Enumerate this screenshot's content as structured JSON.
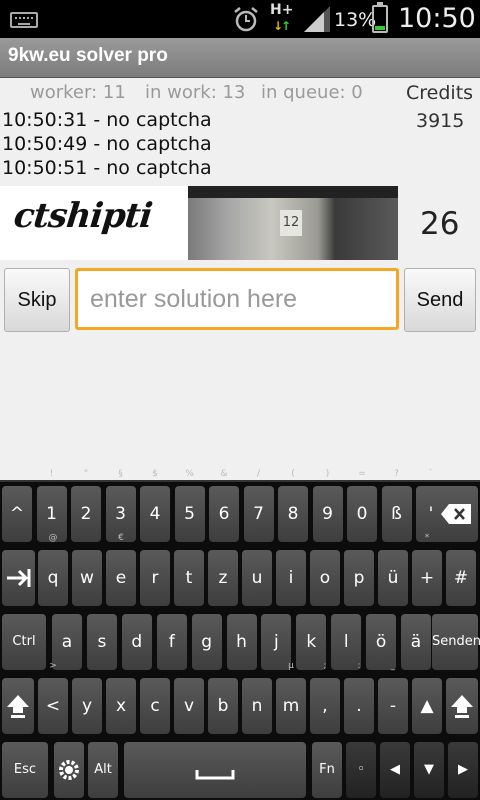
{
  "status": {
    "battery": "13%",
    "clock": "10:50",
    "network": "H+"
  },
  "app": {
    "title": "9kw.eu solver pro"
  },
  "stats": {
    "worker": "worker: 11",
    "in_work": "in work: 13",
    "in_queue": "in queue:  0",
    "credits_label": "Credits",
    "credits_value": "3915"
  },
  "log": [
    "10:50:31 - no captcha",
    "10:50:49 - no captcha",
    "10:50:51 - no captcha"
  ],
  "captcha": {
    "text": "ctshipti",
    "photo_number": "12",
    "counter": "26"
  },
  "controls": {
    "skip_label": "Skip",
    "send_label": "Send",
    "solution_placeholder": "enter solution here"
  },
  "keyboard": {
    "row1": [
      {
        "label": "^",
        "sup": ""
      },
      {
        "label": "1",
        "sup": "!"
      },
      {
        "label": "2",
        "sup": "\""
      },
      {
        "label": "3",
        "sup": "§"
      },
      {
        "label": "4",
        "sup": "$"
      },
      {
        "label": "5",
        "sup": "%"
      },
      {
        "label": "6",
        "sup": "&"
      },
      {
        "label": "7",
        "sup": "/"
      },
      {
        "label": "8",
        "sup": "("
      },
      {
        "label": "9",
        "sup": ")"
      },
      {
        "label": "0",
        "sup": "="
      },
      {
        "label": "ß",
        "sup": "?"
      },
      {
        "label": "'",
        "sup": "`"
      }
    ],
    "row2": [
      {
        "label": "q",
        "sup": "@"
      },
      {
        "label": "w",
        "sup": ""
      },
      {
        "label": "e",
        "sup": "€"
      },
      {
        "label": "r",
        "sup": ""
      },
      {
        "label": "t",
        "sup": ""
      },
      {
        "label": "z",
        "sup": ""
      },
      {
        "label": "u",
        "sup": ""
      },
      {
        "label": "i",
        "sup": ""
      },
      {
        "label": "o",
        "sup": ""
      },
      {
        "label": "p",
        "sup": ""
      },
      {
        "label": "ü",
        "sup": ""
      },
      {
        "label": "+",
        "sup": "*"
      },
      {
        "label": "#",
        "sup": "'"
      }
    ],
    "row3": [
      {
        "label": "a",
        "sup": ""
      },
      {
        "label": "s",
        "sup": ""
      },
      {
        "label": "d",
        "sup": ""
      },
      {
        "label": "f",
        "sup": ""
      },
      {
        "label": "g",
        "sup": ""
      },
      {
        "label": "h",
        "sup": ""
      },
      {
        "label": "j",
        "sup": ""
      },
      {
        "label": "k",
        "sup": ""
      },
      {
        "label": "l",
        "sup": ""
      },
      {
        "label": "ö",
        "sup": ""
      },
      {
        "label": "ä",
        "sup": ""
      }
    ],
    "row4": [
      {
        "label": "<",
        "sup": ">"
      },
      {
        "label": "y",
        "sup": ""
      },
      {
        "label": "x",
        "sup": ""
      },
      {
        "label": "c",
        "sup": ""
      },
      {
        "label": "v",
        "sup": ""
      },
      {
        "label": "b",
        "sup": ""
      },
      {
        "label": "n",
        "sup": ""
      },
      {
        "label": "m",
        "sup": "µ"
      },
      {
        "label": ",",
        "sup": ";"
      },
      {
        "label": ".",
        "sup": ":"
      },
      {
        "label": "-",
        "sup": "_"
      },
      {
        "label": "▲",
        "sup": ""
      }
    ],
    "ctrl_label": "Ctrl",
    "senden_label": "Senden",
    "esc_label": "Esc",
    "alt_label": "Alt",
    "fn_label": "Fn",
    "nav_row": [
      "◦",
      "◀",
      "▼",
      "▶"
    ]
  }
}
